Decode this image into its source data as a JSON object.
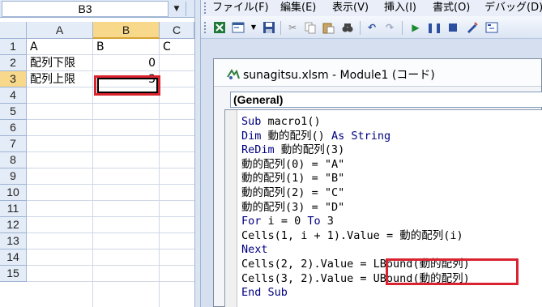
{
  "excel": {
    "name_box": "B3",
    "columns": [
      "A",
      "B",
      "C"
    ],
    "rows": [
      "1",
      "2",
      "3",
      "4",
      "5",
      "6",
      "7",
      "8",
      "9",
      "10",
      "11",
      "12",
      "13",
      "14",
      "15"
    ],
    "cells": {
      "A1": "A",
      "B1": "B",
      "C1": "C",
      "A2": "配列下限",
      "B2": "0",
      "A3": "配列上限",
      "B3": "3"
    },
    "selected_cell": "B3"
  },
  "vbe": {
    "menu": [
      "ファイル(F)",
      "編集(E)",
      "表示(V)",
      "挿入(I)",
      "書式(O)",
      "デバッグ(D)"
    ],
    "toolbar_icons": [
      "excel-icon",
      "userform-icon",
      "dropdown-arrow-icon",
      "save-icon",
      "cut-icon",
      "copy-icon",
      "paste-icon",
      "find-icon",
      "undo-icon",
      "redo-icon",
      "run-icon",
      "pause-icon",
      "reset-icon",
      "design-mode-icon",
      "project-explorer-icon"
    ],
    "window_title": "sunagitsu.xlsm - Module1 (コード)",
    "object_combo": "(General)",
    "code": [
      "Sub macro1()",
      "Dim 動的配列() As String",
      "ReDim 動的配列(3)",
      "動的配列(0) = \"A\"",
      "動的配列(1) = \"B\"",
      "動的配列(2) = \"C\"",
      "動的配列(3) = \"D\"",
      "For i = 0 To 3",
      "Cells(1, i + 1).Value = 動的配列(i)",
      "Next",
      "Cells(2, 2).Value = LBound(動的配列)",
      "Cells(3, 2).Value = UBound(動的配列)",
      "End Sub"
    ]
  },
  "colors": {
    "highlight_red": "#d9232f",
    "keyword_blue": "#00007f",
    "header_selected": "#f8d88a"
  }
}
